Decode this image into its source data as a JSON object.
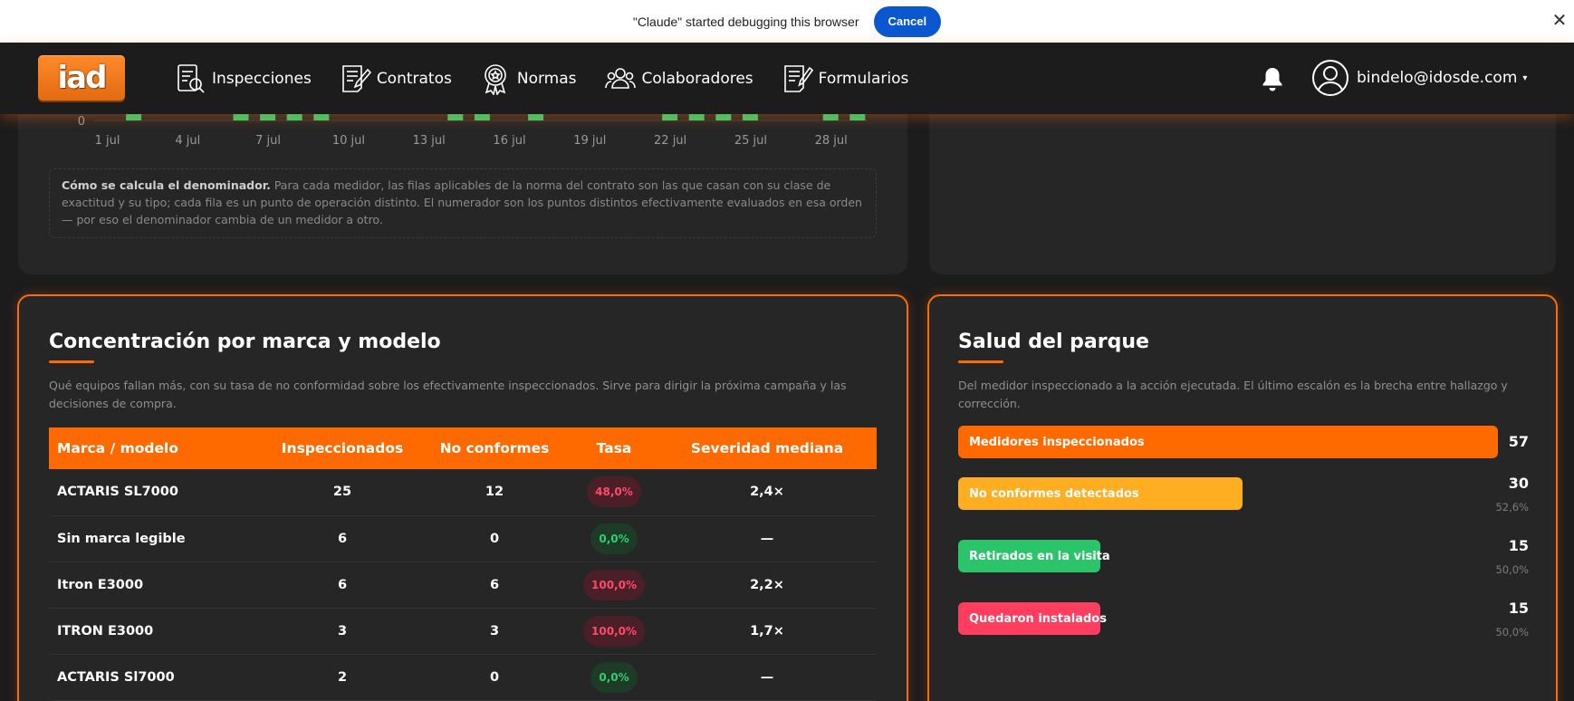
{
  "debug_bar": {
    "message": "\"Claude\" started debugging this browser",
    "cancel_label": "Cancel",
    "close_glyph": "✕"
  },
  "navbar": {
    "logo_text": "iad",
    "items": [
      {
        "label": "Inspecciones",
        "icon": "inspection-icon"
      },
      {
        "label": "Contratos",
        "icon": "contract-icon"
      },
      {
        "label": "Normas",
        "icon": "badge-icon"
      },
      {
        "label": "Colaboradores",
        "icon": "users-icon"
      },
      {
        "label": "Formularios",
        "icon": "form-icon"
      }
    ],
    "user_email": "bindelo@idosde.com",
    "caret": "▾"
  },
  "top_chart": {
    "y_tick": "0",
    "x_ticks": [
      "1 jul",
      "4 jul",
      "7 jul",
      "10 jul",
      "13 jul",
      "16 jul",
      "19 jul",
      "22 jul",
      "25 jul",
      "28 jul"
    ],
    "bar_days": [
      2,
      6,
      7,
      8,
      9,
      14,
      15,
      17,
      22,
      23,
      24,
      25,
      28,
      29
    ],
    "bar_color": "#2fcf6f"
  },
  "note": {
    "bold": "Cómo se calcula el denominador.",
    "text": " Para cada medidor, las filas aplicables de la norma del contrato son las que casan con su clase de exactitud y su tipo; cada fila es un punto de operación distinto. El numerador son los puntos distintos efectivamente evaluados en esa orden — por eso el denominador cambia de un medidor a otro."
  },
  "brand_card": {
    "title": "Concentración por marca y modelo",
    "description": "Qué equipos fallan más, con su tasa de no conformidad sobre los efectivamente inspeccionados. Sirve para dirigir la próxima campaña y las decisiones de compra.",
    "columns": [
      "Marca / modelo",
      "Inspeccionados",
      "No conformes",
      "Tasa",
      "Severidad mediana"
    ],
    "rows": [
      {
        "model": "ACTARIS SL7000",
        "inspected": "25",
        "nonconforming": "12",
        "rate": "48,0%",
        "rate_status": "bad",
        "severity": "2,4×"
      },
      {
        "model": "Sin marca legible",
        "inspected": "6",
        "nonconforming": "0",
        "rate": "0,0%",
        "rate_status": "good",
        "severity": "—"
      },
      {
        "model": "Itron E3000",
        "inspected": "6",
        "nonconforming": "6",
        "rate": "100,0%",
        "rate_status": "bad",
        "severity": "2,2×"
      },
      {
        "model": "ITRON E3000",
        "inspected": "3",
        "nonconforming": "3",
        "rate": "100,0%",
        "rate_status": "bad",
        "severity": "1,7×"
      },
      {
        "model": "ACTARIS Sl7000",
        "inspected": "2",
        "nonconforming": "0",
        "rate": "0,0%",
        "rate_status": "good",
        "severity": "—"
      }
    ]
  },
  "health_card": {
    "title": "Salud del parque",
    "description": "Del medidor inspeccionado a la acción ejecutada. El último escalón es la brecha entre hallazgo y corrección.",
    "steps": [
      {
        "label": "Medidores inspeccionados",
        "count": "57",
        "value": 57,
        "percent": "",
        "color": "#ff6a00"
      },
      {
        "label": "No conformes detectados",
        "count": "30",
        "value": 30,
        "percent": "52,6%",
        "color": "#ffae22"
      },
      {
        "label": "Retirados en la visita",
        "count": "15",
        "value": 15,
        "percent": "50,0%",
        "color": "#2cc46b"
      },
      {
        "label": "Quedaron instalados",
        "count": "15",
        "value": 15,
        "percent": "50,0%",
        "color": "#ff3d5e"
      }
    ]
  },
  "colors": {
    "accent": "#ff6a00",
    "card_bg": "#262626",
    "page_bg": "#1c1c1c"
  }
}
